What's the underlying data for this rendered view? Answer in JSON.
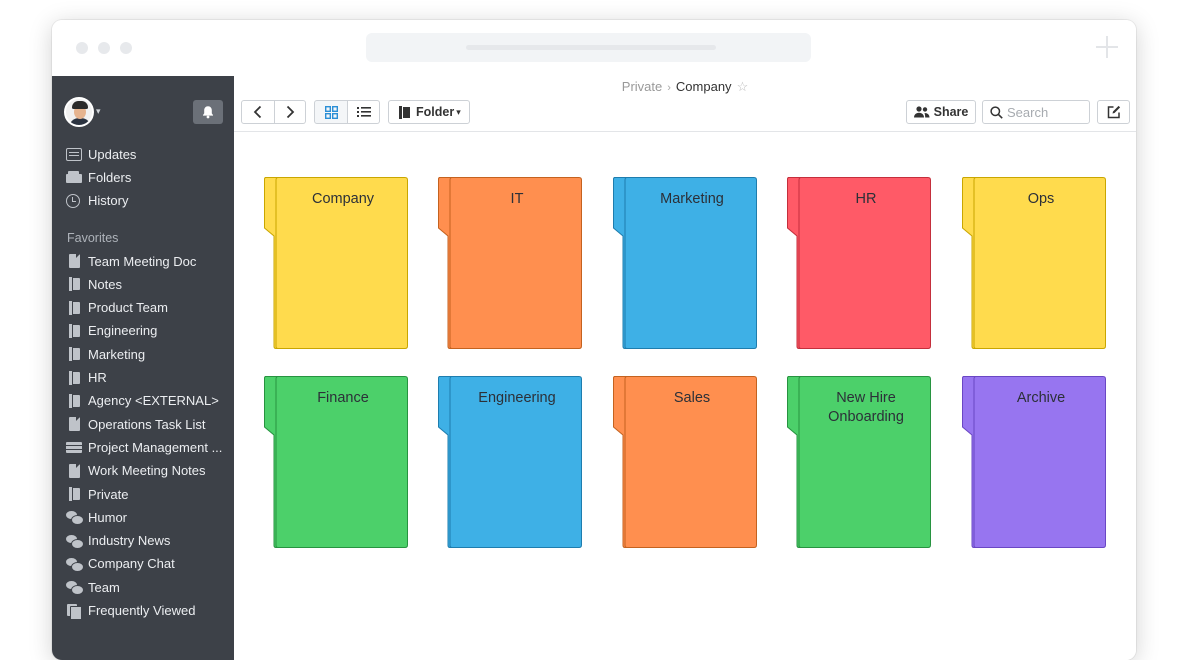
{
  "breadcrumb": {
    "parent": "Private",
    "separator": "›",
    "current": "Company",
    "star": "☆"
  },
  "toolbar": {
    "folder_label": "Folder",
    "folder_caret": "▾",
    "share_label": "Share",
    "search_placeholder": "Search"
  },
  "sidebar": {
    "nav": [
      {
        "label": "Updates",
        "icon": "updates-icon"
      },
      {
        "label": "Folders",
        "icon": "folders-icon"
      },
      {
        "label": "History",
        "icon": "history-icon"
      }
    ],
    "favorites_heading": "Favorites",
    "favorites": [
      {
        "label": "Team Meeting Doc",
        "icon": "document-icon"
      },
      {
        "label": "Notes",
        "icon": "folder-icon"
      },
      {
        "label": "Product Team",
        "icon": "folder-icon"
      },
      {
        "label": "Engineering",
        "icon": "folder-icon"
      },
      {
        "label": "Marketing",
        "icon": "folder-icon"
      },
      {
        "label": "HR",
        "icon": "folder-icon"
      },
      {
        "label": "Agency <EXTERNAL>",
        "icon": "folder-icon"
      },
      {
        "label": "Operations Task List",
        "icon": "document-icon"
      },
      {
        "label": "Project Management ...",
        "icon": "spreadsheet-icon"
      },
      {
        "label": "Work Meeting Notes",
        "icon": "document-icon"
      },
      {
        "label": "Private",
        "icon": "folder-icon"
      },
      {
        "label": "Humor",
        "icon": "chat-icon"
      },
      {
        "label": "Industry News",
        "icon": "chat-icon"
      },
      {
        "label": "Company Chat",
        "icon": "chat-icon"
      },
      {
        "label": "Team",
        "icon": "chat-icon"
      },
      {
        "label": "Frequently Viewed",
        "icon": "frequently-viewed-icon"
      }
    ]
  },
  "folders": [
    {
      "label": "Company",
      "color": "#FFDB4D",
      "border": "#C9A600"
    },
    {
      "label": "IT",
      "color": "#FF8F4F",
      "border": "#C4621F"
    },
    {
      "label": "Marketing",
      "color": "#3EB0E6",
      "border": "#1E7DAE"
    },
    {
      "label": "HR",
      "color": "#FF5A67",
      "border": "#C42F3C"
    },
    {
      "label": "Ops",
      "color": "#FFDB4D",
      "border": "#C9A600"
    },
    {
      "label": "Finance",
      "color": "#4CD06A",
      "border": "#279340"
    },
    {
      "label": "Engineering",
      "color": "#3EB0E6",
      "border": "#1E7DAE"
    },
    {
      "label": "Sales",
      "color": "#FF8F4F",
      "border": "#C4621F"
    },
    {
      "label": "New Hire Onboarding",
      "color": "#4CD06A",
      "border": "#279340"
    },
    {
      "label": "Archive",
      "color": "#9775F0",
      "border": "#6A47C4"
    }
  ]
}
